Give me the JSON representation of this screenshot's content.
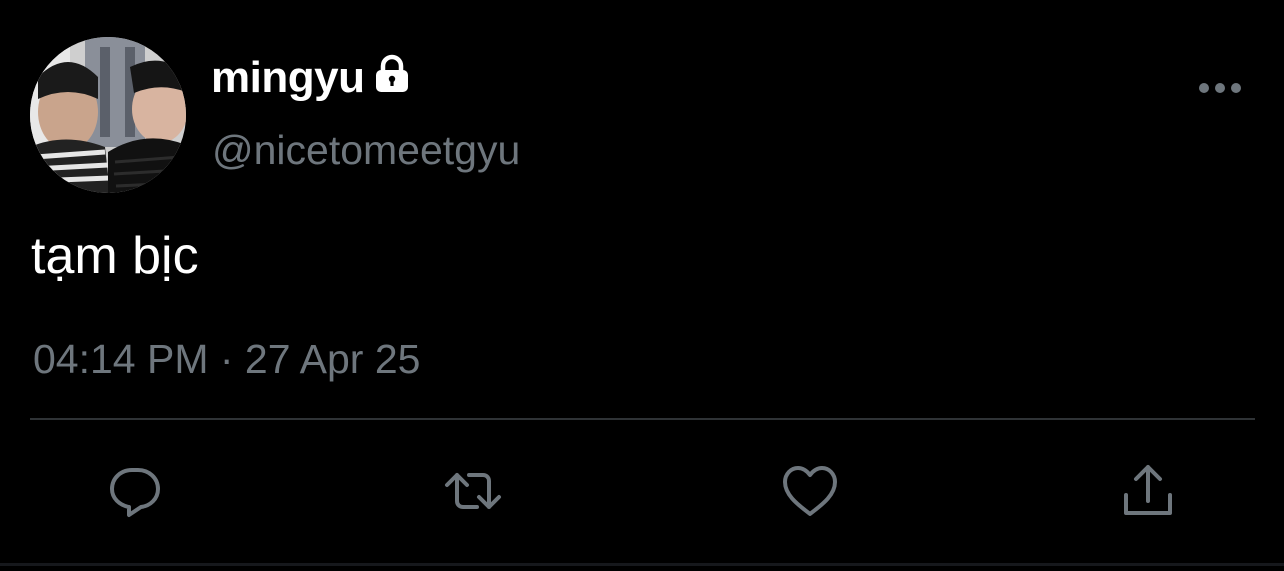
{
  "user": {
    "display_name": "mingyu",
    "handle": "@nicetomeetgyu",
    "protected_icon": "lock-icon",
    "avatar": "profile-photo"
  },
  "tweet": {
    "text": "tạm bịc",
    "timestamp": "04:14 PM · 27 Apr 25"
  },
  "menu": {
    "icon": "more-horizontal-icon"
  },
  "actions": [
    {
      "name": "reply",
      "icon": "reply-icon"
    },
    {
      "name": "retweet",
      "icon": "retweet-icon"
    },
    {
      "name": "like",
      "icon": "heart-icon"
    },
    {
      "name": "share",
      "icon": "share-icon"
    }
  ],
  "colors": {
    "background": "#000000",
    "primary_text": "#ffffff",
    "secondary_text": "#6e767d",
    "divider": "#2f3336"
  }
}
